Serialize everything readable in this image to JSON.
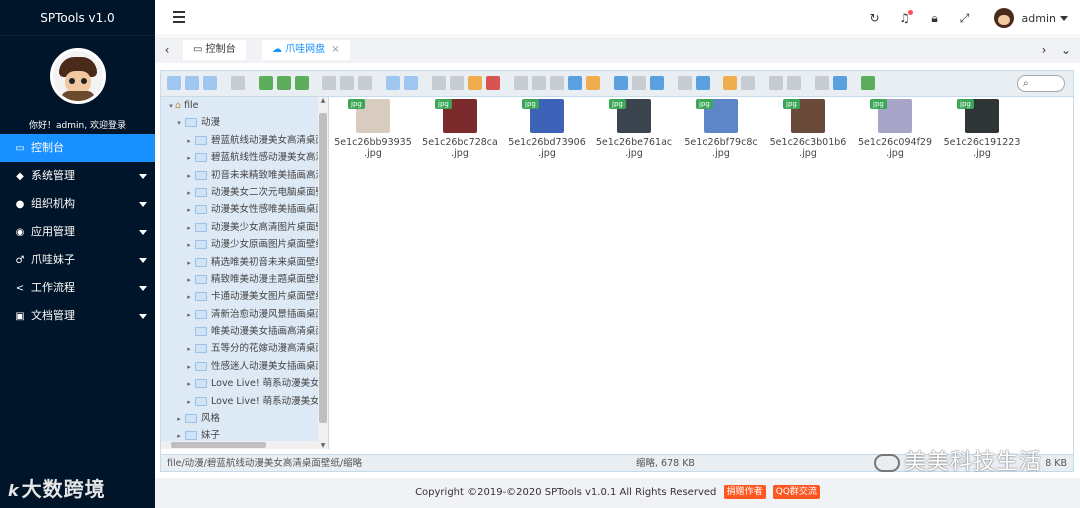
{
  "app": {
    "brand": "SPTools v1.0",
    "welcome": "你好！admin, 欢迎登录",
    "logo_text": "大数跨境",
    "logo_mark": "k"
  },
  "sidebar": {
    "items": [
      {
        "label": "控制台",
        "icon": "monitor-icon",
        "active": true,
        "expandable": false
      },
      {
        "label": "系统管理",
        "icon": "layers-icon",
        "active": false,
        "expandable": true
      },
      {
        "label": "组织机构",
        "icon": "users-icon",
        "active": false,
        "expandable": true
      },
      {
        "label": "应用管理",
        "icon": "compass-icon",
        "active": false,
        "expandable": true
      },
      {
        "label": "爪哇妹子",
        "icon": "key-icon",
        "active": false,
        "expandable": true
      },
      {
        "label": "工作流程",
        "icon": "share-icon",
        "active": false,
        "expandable": true
      },
      {
        "label": "文档管理",
        "icon": "book-icon",
        "active": false,
        "expandable": true
      }
    ]
  },
  "header": {
    "user": "admin"
  },
  "tabs": [
    {
      "label": "控制台",
      "icon": "monitor-icon",
      "active": false
    },
    {
      "label": "爪哇网盘",
      "icon": "cloud-icon",
      "active": true
    }
  ],
  "tree": {
    "root": "file",
    "items": [
      {
        "label": "动漫",
        "level": 1,
        "expanded": true
      },
      {
        "label": "碧蓝航线动漫美女高清桌面壁纸",
        "level": 2
      },
      {
        "label": "碧蓝航线性感动漫美女高清桌面壁纸",
        "level": 2
      },
      {
        "label": "初音未来精致唯美插画高清桌面壁纸",
        "level": 2
      },
      {
        "label": "动漫美女二次元电脑桌面壁纸",
        "level": 2
      },
      {
        "label": "动漫美女性感唯美插画桌面壁纸",
        "level": 2
      },
      {
        "label": "动漫美少女高清图片桌面壁纸",
        "level": 2
      },
      {
        "label": "动漫少女原画图片桌面壁纸",
        "level": 2
      },
      {
        "label": "精选唯美初音未来桌面壁纸",
        "level": 2
      },
      {
        "label": "精致唯美动漫主题桌面壁纸",
        "level": 2
      },
      {
        "label": "卡通动漫美女图片桌面壁纸",
        "level": 2
      },
      {
        "label": "清新治愈动漫风景插画桌面壁纸",
        "level": 2
      },
      {
        "label": "唯美动漫美女插画高清桌面壁纸",
        "level": 2,
        "leaf": true
      },
      {
        "label": "五等分的花嫁动漫高清桌面壁纸",
        "level": 2
      },
      {
        "label": "性感迷人动漫美女插画桌面壁纸",
        "level": 2
      },
      {
        "label": "Love Live! 萌系动漫美女高清桌面壁纸",
        "level": 2
      },
      {
        "label": "Love Live! 萌系动漫美女高清桌面壁纸",
        "level": 2
      },
      {
        "label": "风格",
        "level": 1
      },
      {
        "label": "妹子",
        "level": 1
      }
    ]
  },
  "files": [
    {
      "name": "5e1c26bb93935",
      "ext": ".jpg",
      "badge": "jpg",
      "color": "#d8cbbf"
    },
    {
      "name": "5e1c26bc728ca",
      "ext": ".jpg",
      "badge": "jpg",
      "color": "#7a2a2a"
    },
    {
      "name": "5e1c26bd73906",
      "ext": ".jpg",
      "badge": "jpg",
      "color": "#3d63b8"
    },
    {
      "name": "5e1c26be761ac",
      "ext": ".jpg",
      "badge": "jpg",
      "color": "#3c4450"
    },
    {
      "name": "5e1c26bf79c8c",
      "ext": ".jpg",
      "badge": "jpg",
      "color": "#5d86c8"
    },
    {
      "name": "5e1c26c3b01b6",
      "ext": ".jpg",
      "badge": "jpg",
      "color": "#6a4a3a"
    },
    {
      "name": "5e1c26c094f29",
      "ext": ".jpg",
      "badge": "jpg",
      "color": "#a7a6c9"
    },
    {
      "name": "5e1c26c191223",
      "ext": ".jpg",
      "badge": "jpg",
      "color": "#2f3436"
    }
  ],
  "status": {
    "path": "file/动漫/碧蓝航线动漫美女高清桌面壁纸/缩略",
    "mid": "缩略, 678 KB",
    "right": "8 KB"
  },
  "watermark": "美美科技生活",
  "footer": {
    "copyright": "Copyright ©2019-©2020 SPTools v1.0.1 All Rights Reserved",
    "btn1": "捐赠作者",
    "btn2": "QQ群交流"
  },
  "search": {
    "placeholder": ""
  }
}
